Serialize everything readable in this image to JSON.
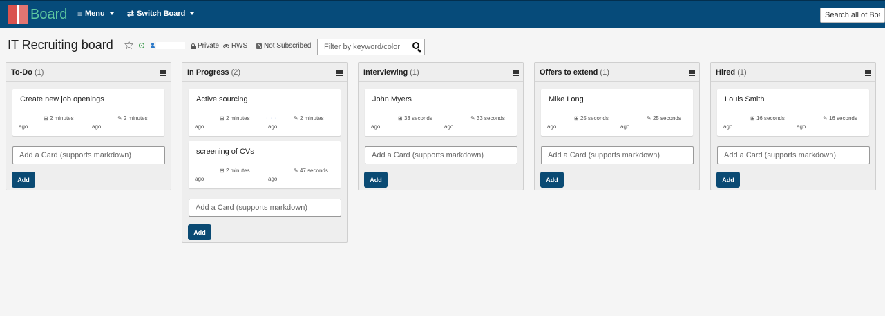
{
  "navbar": {
    "brand": "Board",
    "menu_label": "Menu",
    "menu_icon": "hamburger-icon",
    "switch_label": "Switch Board",
    "switch_icon": "arrows-swap-icon",
    "search_placeholder": "Search all of Boards",
    "background": "#064b7a"
  },
  "board": {
    "title": "IT Recruiting board",
    "visibility": "Private",
    "permission": "RWS",
    "subscription": "Not Subscribed",
    "filter_placeholder": "Filter by keyword/color"
  },
  "lists": [
    {
      "title": "To-Do",
      "count": "(1)",
      "cards": [
        {
          "title": "Create new job openings",
          "created": "2 minutes",
          "modified": "2 minutes",
          "ago": "ago"
        }
      ],
      "add_placeholder": "Add a Card (supports markdown)",
      "add_label": "Add"
    },
    {
      "title": "In Progress",
      "count": "(2)",
      "cards": [
        {
          "title": "Active sourcing",
          "created": "2 minutes",
          "modified": "2 minutes",
          "ago": "ago"
        },
        {
          "title": "screening of CVs",
          "created": "2 minutes",
          "modified": "47 seconds",
          "ago": "ago"
        }
      ],
      "add_placeholder": "Add a Card (supports markdown)",
      "add_label": "Add"
    },
    {
      "title": "Interviewing",
      "count": "(1)",
      "cards": [
        {
          "title": "John Myers",
          "created": "33 seconds",
          "modified": "33 seconds",
          "ago": "ago"
        }
      ],
      "add_placeholder": "Add a Card (supports markdown)",
      "add_label": "Add"
    },
    {
      "title": "Offers to extend",
      "count": "(1)",
      "cards": [
        {
          "title": "Mike Long",
          "created": "25 seconds",
          "modified": "25 seconds",
          "ago": "ago"
        }
      ],
      "add_placeholder": "Add a Card (supports markdown)",
      "add_label": "Add"
    },
    {
      "title": "Hired",
      "count": "(1)",
      "cards": [
        {
          "title": "Louis Smith",
          "created": "16 seconds",
          "modified": "16 seconds",
          "ago": "ago"
        }
      ],
      "add_placeholder": "Add a Card (supports markdown)",
      "add_label": "Add"
    }
  ]
}
